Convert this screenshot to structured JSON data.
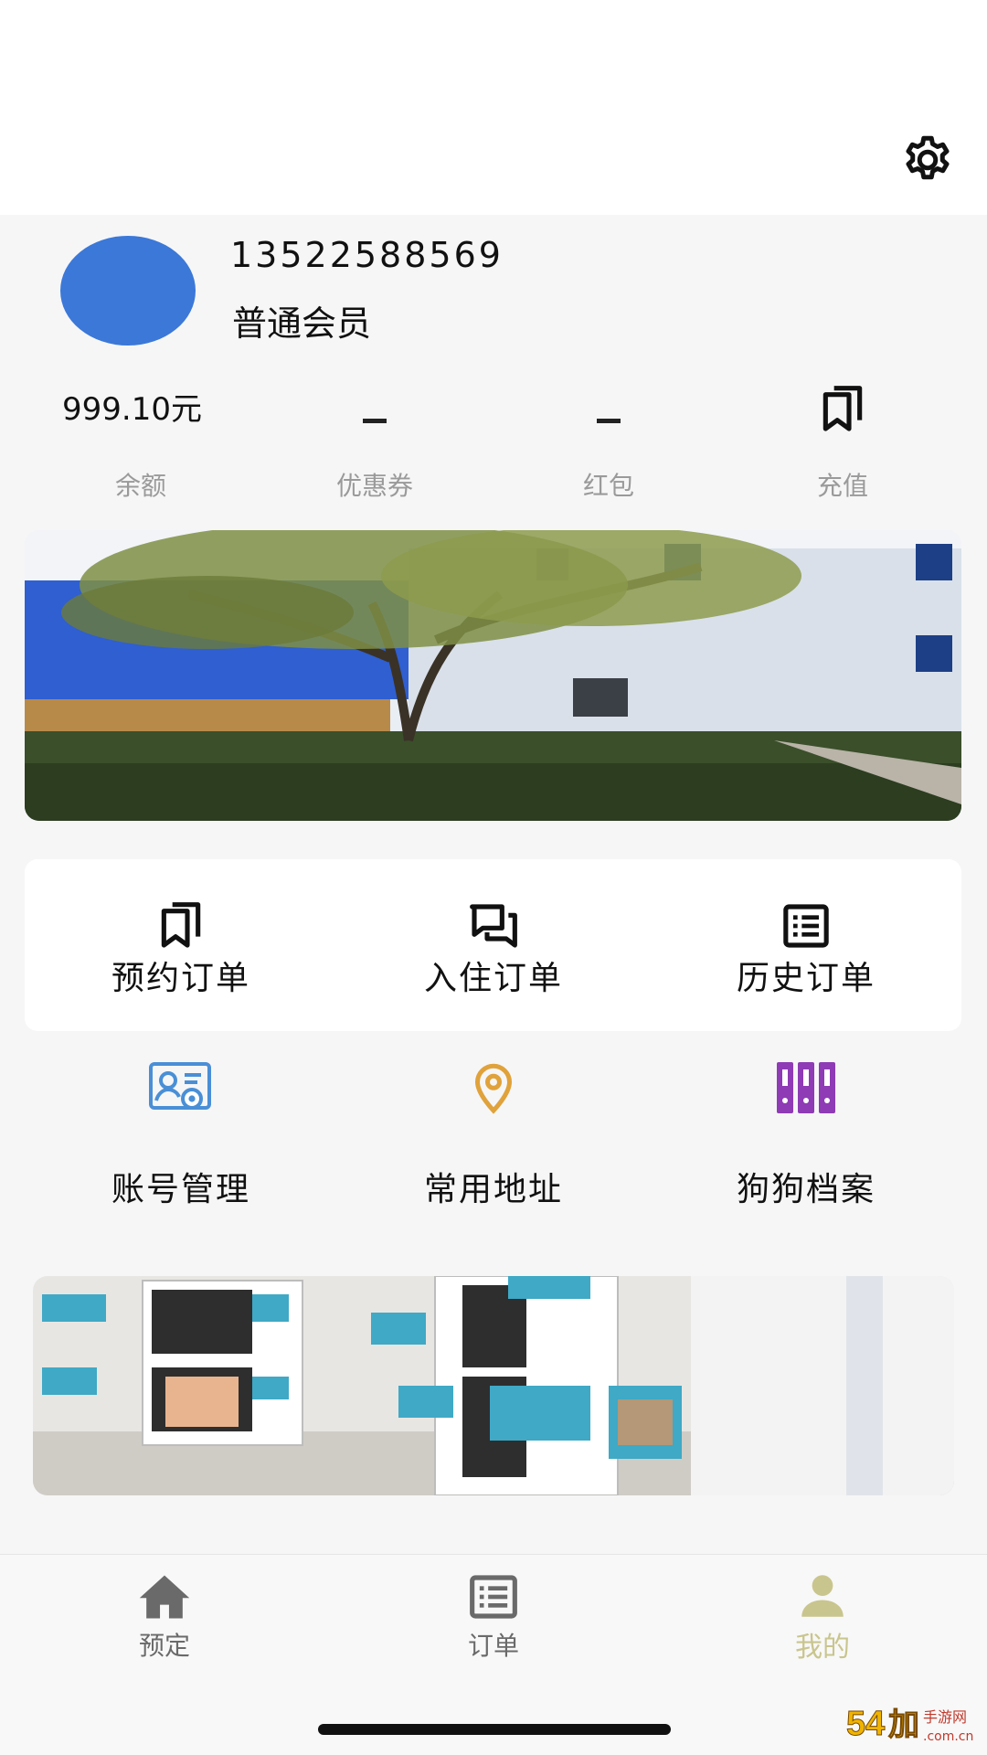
{
  "header": {
    "settings_icon": "gear-icon"
  },
  "profile": {
    "phone": "13522588569",
    "member_level": "普通会员",
    "avatar_color": "#3b78d8"
  },
  "stats": {
    "balance": {
      "value": "999.10元",
      "label": "余额"
    },
    "coupon": {
      "value": "-",
      "label": "优惠券"
    },
    "red_packet": {
      "value": "-",
      "label": "红包"
    },
    "recharge": {
      "label": "充值",
      "icon": "bookmark-icon"
    }
  },
  "orders": {
    "items": [
      {
        "label": "预约订单",
        "icon": "bookmark-icon"
      },
      {
        "label": "入住订单",
        "icon": "chat-icon"
      },
      {
        "label": "历史订单",
        "icon": "list-icon"
      }
    ]
  },
  "services": {
    "items": [
      {
        "label": "账号管理",
        "icon": "account-settings-icon",
        "color": "#4a8fd6"
      },
      {
        "label": "常用地址",
        "icon": "location-pin-icon",
        "color": "#e0a23a"
      },
      {
        "label": "狗狗档案",
        "icon": "archive-binders-icon",
        "color": "#8e3bb5"
      }
    ]
  },
  "tabbar": {
    "tabs": [
      {
        "label": "预定",
        "icon": "home-icon",
        "active": false
      },
      {
        "label": "订单",
        "icon": "list-icon",
        "active": false
      },
      {
        "label": "我的",
        "icon": "user-icon",
        "active": true
      }
    ],
    "active_color": "#c9c58e",
    "inactive_color": "#6a6a6a"
  },
  "watermark": {
    "text": "54加手游网 .com.cn"
  }
}
